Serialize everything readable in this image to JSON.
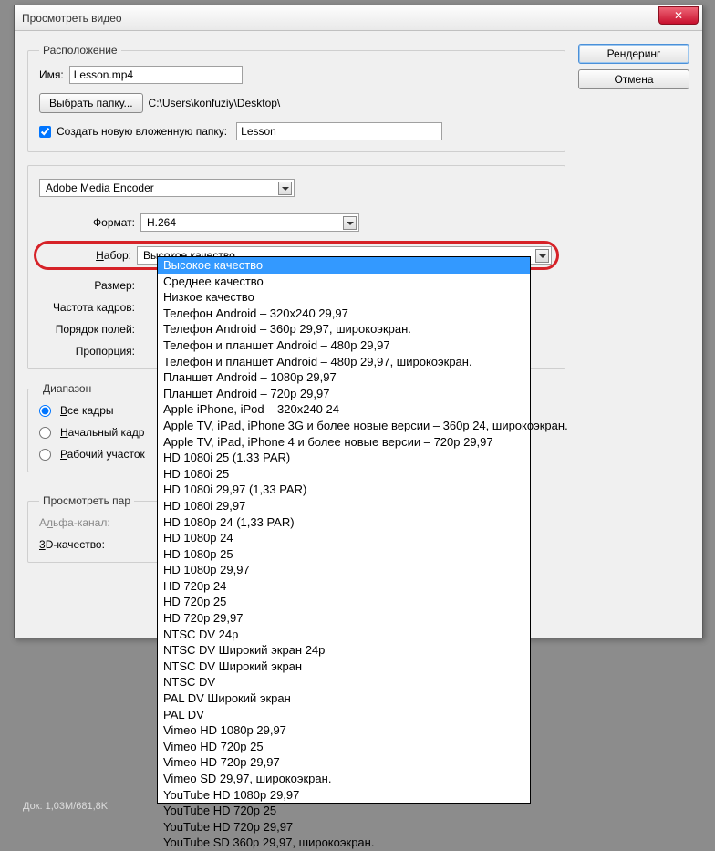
{
  "window": {
    "title": "Просмотреть видео"
  },
  "buttons": {
    "render": "Рендеринг",
    "cancel": "Отмена",
    "close": "✕"
  },
  "location": {
    "legend": "Расположение",
    "name_label": "Имя:",
    "name_value": "Lesson.mp4",
    "choose_folder": "Выбрать папку...",
    "path": "C:\\Users\\konfuziy\\Desktop\\",
    "subfolder_label": "Создать новую вложенную папку:",
    "subfolder_value": "Lesson"
  },
  "encoder": {
    "combo": "Adobe Media Encoder",
    "format_label": "Формат:",
    "format_value": "H.264",
    "preset_label": "Набор:",
    "preset_value": "Высокое качество",
    "size_label": "Размер:",
    "fps_label": "Частота кадров:",
    "field_order_label": "Порядок полей:",
    "aspect_label": "Пропорция:"
  },
  "range": {
    "legend": "Диапазон",
    "all": "Все кадры",
    "start": "Начальный кадр",
    "work": "Рабочий участок"
  },
  "preview": {
    "legend": "Просмотреть пар",
    "alpha_label": "Альфа-канал:",
    "quality3d_label": "3D-качество:"
  },
  "status_bar": "Док: 1,03M/681,8K",
  "preset_options": [
    "Высокое качество",
    "Среднее качество",
    "Низкое качество",
    "Телефон Android – 320x240 29,97",
    "Телефон Android – 360p 29,97, широкоэкран.",
    "Телефон и планшет Android – 480p 29,97",
    "Телефон и планшет Android – 480p 29,97, широкоэкран.",
    "Планшет Android – 1080p 29,97",
    "Планшет Android – 720p 29,97",
    "Apple iPhone, iPod – 320x240 24",
    "Apple TV, iPad, iPhone 3G и более новые версии – 360p 24, широкоэкран.",
    "Apple TV, iPad, iPhone 4 и более новые версии – 720p 29,97",
    "HD 1080i 25 (1.33 PAR)",
    "HD 1080i 25",
    "HD 1080i 29,97 (1,33 PAR)",
    "HD 1080i 29,97",
    "HD 1080p 24 (1,33 PAR)",
    "HD 1080p 24",
    "HD 1080p 25",
    "HD 1080p 29,97",
    "HD 720p 24",
    "HD 720p 25",
    "HD 720p 29,97",
    "NTSC DV 24p",
    "NTSC DV Широкий экран 24p",
    "NTSC DV Широкий экран",
    "NTSC DV",
    "PAL DV Широкий экран",
    "PAL DV",
    "Vimeo HD 1080p 29,97",
    "Vimeo HD 720p 25",
    "Vimeo HD 720p 29,97",
    "Vimeo SD 29,97, широкоэкран.",
    "YouTube HD 1080p 29,97",
    "YouTube HD 720p 25",
    "YouTube HD 720p 29,97",
    "YouTube SD 360p 29,97, широкоэкран."
  ]
}
